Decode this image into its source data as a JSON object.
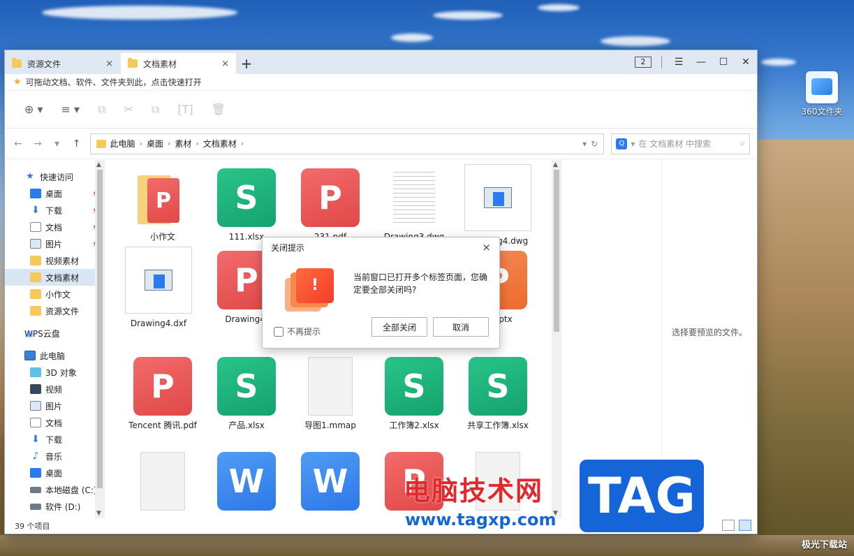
{
  "desktop": {
    "icon_label": "360文件夹"
  },
  "tabs": [
    {
      "label": "资源文件",
      "close": "×"
    },
    {
      "label": "文档素材",
      "close": "×"
    }
  ],
  "tab_add": "+",
  "tab_count": "2",
  "window_controls": {
    "menu": "☰",
    "minimize": "—",
    "maximize": "☐",
    "close": "✕"
  },
  "favbar": {
    "text": "可拖动文档、软件、文件夹到此，点击快速打开"
  },
  "toolbar": {
    "new": "⊕ ▾",
    "view": "≡ ▾",
    "copy": "⧉",
    "cut": "✂",
    "paste": "⧉",
    "rename": "[T]",
    "delete": "🗑"
  },
  "nav": {
    "back": "←",
    "forward": "→",
    "recent": "▾",
    "up": "↑"
  },
  "address": {
    "crumbs": [
      "此电脑",
      "桌面",
      "素材",
      "文档素材"
    ],
    "sep": "›",
    "dropdown": "▾",
    "refresh": "↻"
  },
  "search": {
    "placeholder": "在 文档素材 中搜索",
    "q": "Q",
    "arrow": "▾",
    "icon": "⌕"
  },
  "sidebar": {
    "quick": "快速访问",
    "quick_items": [
      "桌面",
      "下载",
      "文档",
      "图片",
      "视频素材",
      "文档素材",
      "小作文",
      "资源文件"
    ],
    "pin": "📌",
    "wps": "WPS云盘",
    "pc": "此电脑",
    "pc_items": [
      "3D 对象",
      "视频",
      "图片",
      "文档",
      "下载",
      "音乐",
      "桌面",
      "本地磁盘 (C:)",
      "软件 (D:)"
    ]
  },
  "files": [
    "小作文",
    "111.xlsx",
    "231.pdf",
    "Drawing3.dwg",
    "Drawing4.dwg",
    "Drawing4.dxf",
    "Drawing4.",
    "al.pptx",
    "Tencent 腾讯.pdf",
    "产品.xlsx",
    "导图1.mmap",
    "工作簿2.xlsx",
    "共享工作簿.xlsx"
  ],
  "file_glyphs": {
    "xlsx": "S",
    "pdf": "P",
    "docx": "W"
  },
  "preview": {
    "text": "选择要预览的文件。"
  },
  "status": {
    "count": "39 个项目"
  },
  "dialog": {
    "title": "关闭提示",
    "close": "×",
    "message": "当前窗口已打开多个标签页面，您确定要全部关闭吗?",
    "checkbox": "不再提示",
    "ok": "全部关闭",
    "cancel": "取消",
    "art_glyph": "!"
  },
  "watermark": {
    "cn": "电脑技术网",
    "url": "www.tagxp.com",
    "tag": "TAG",
    "corner": "极光下载站"
  }
}
